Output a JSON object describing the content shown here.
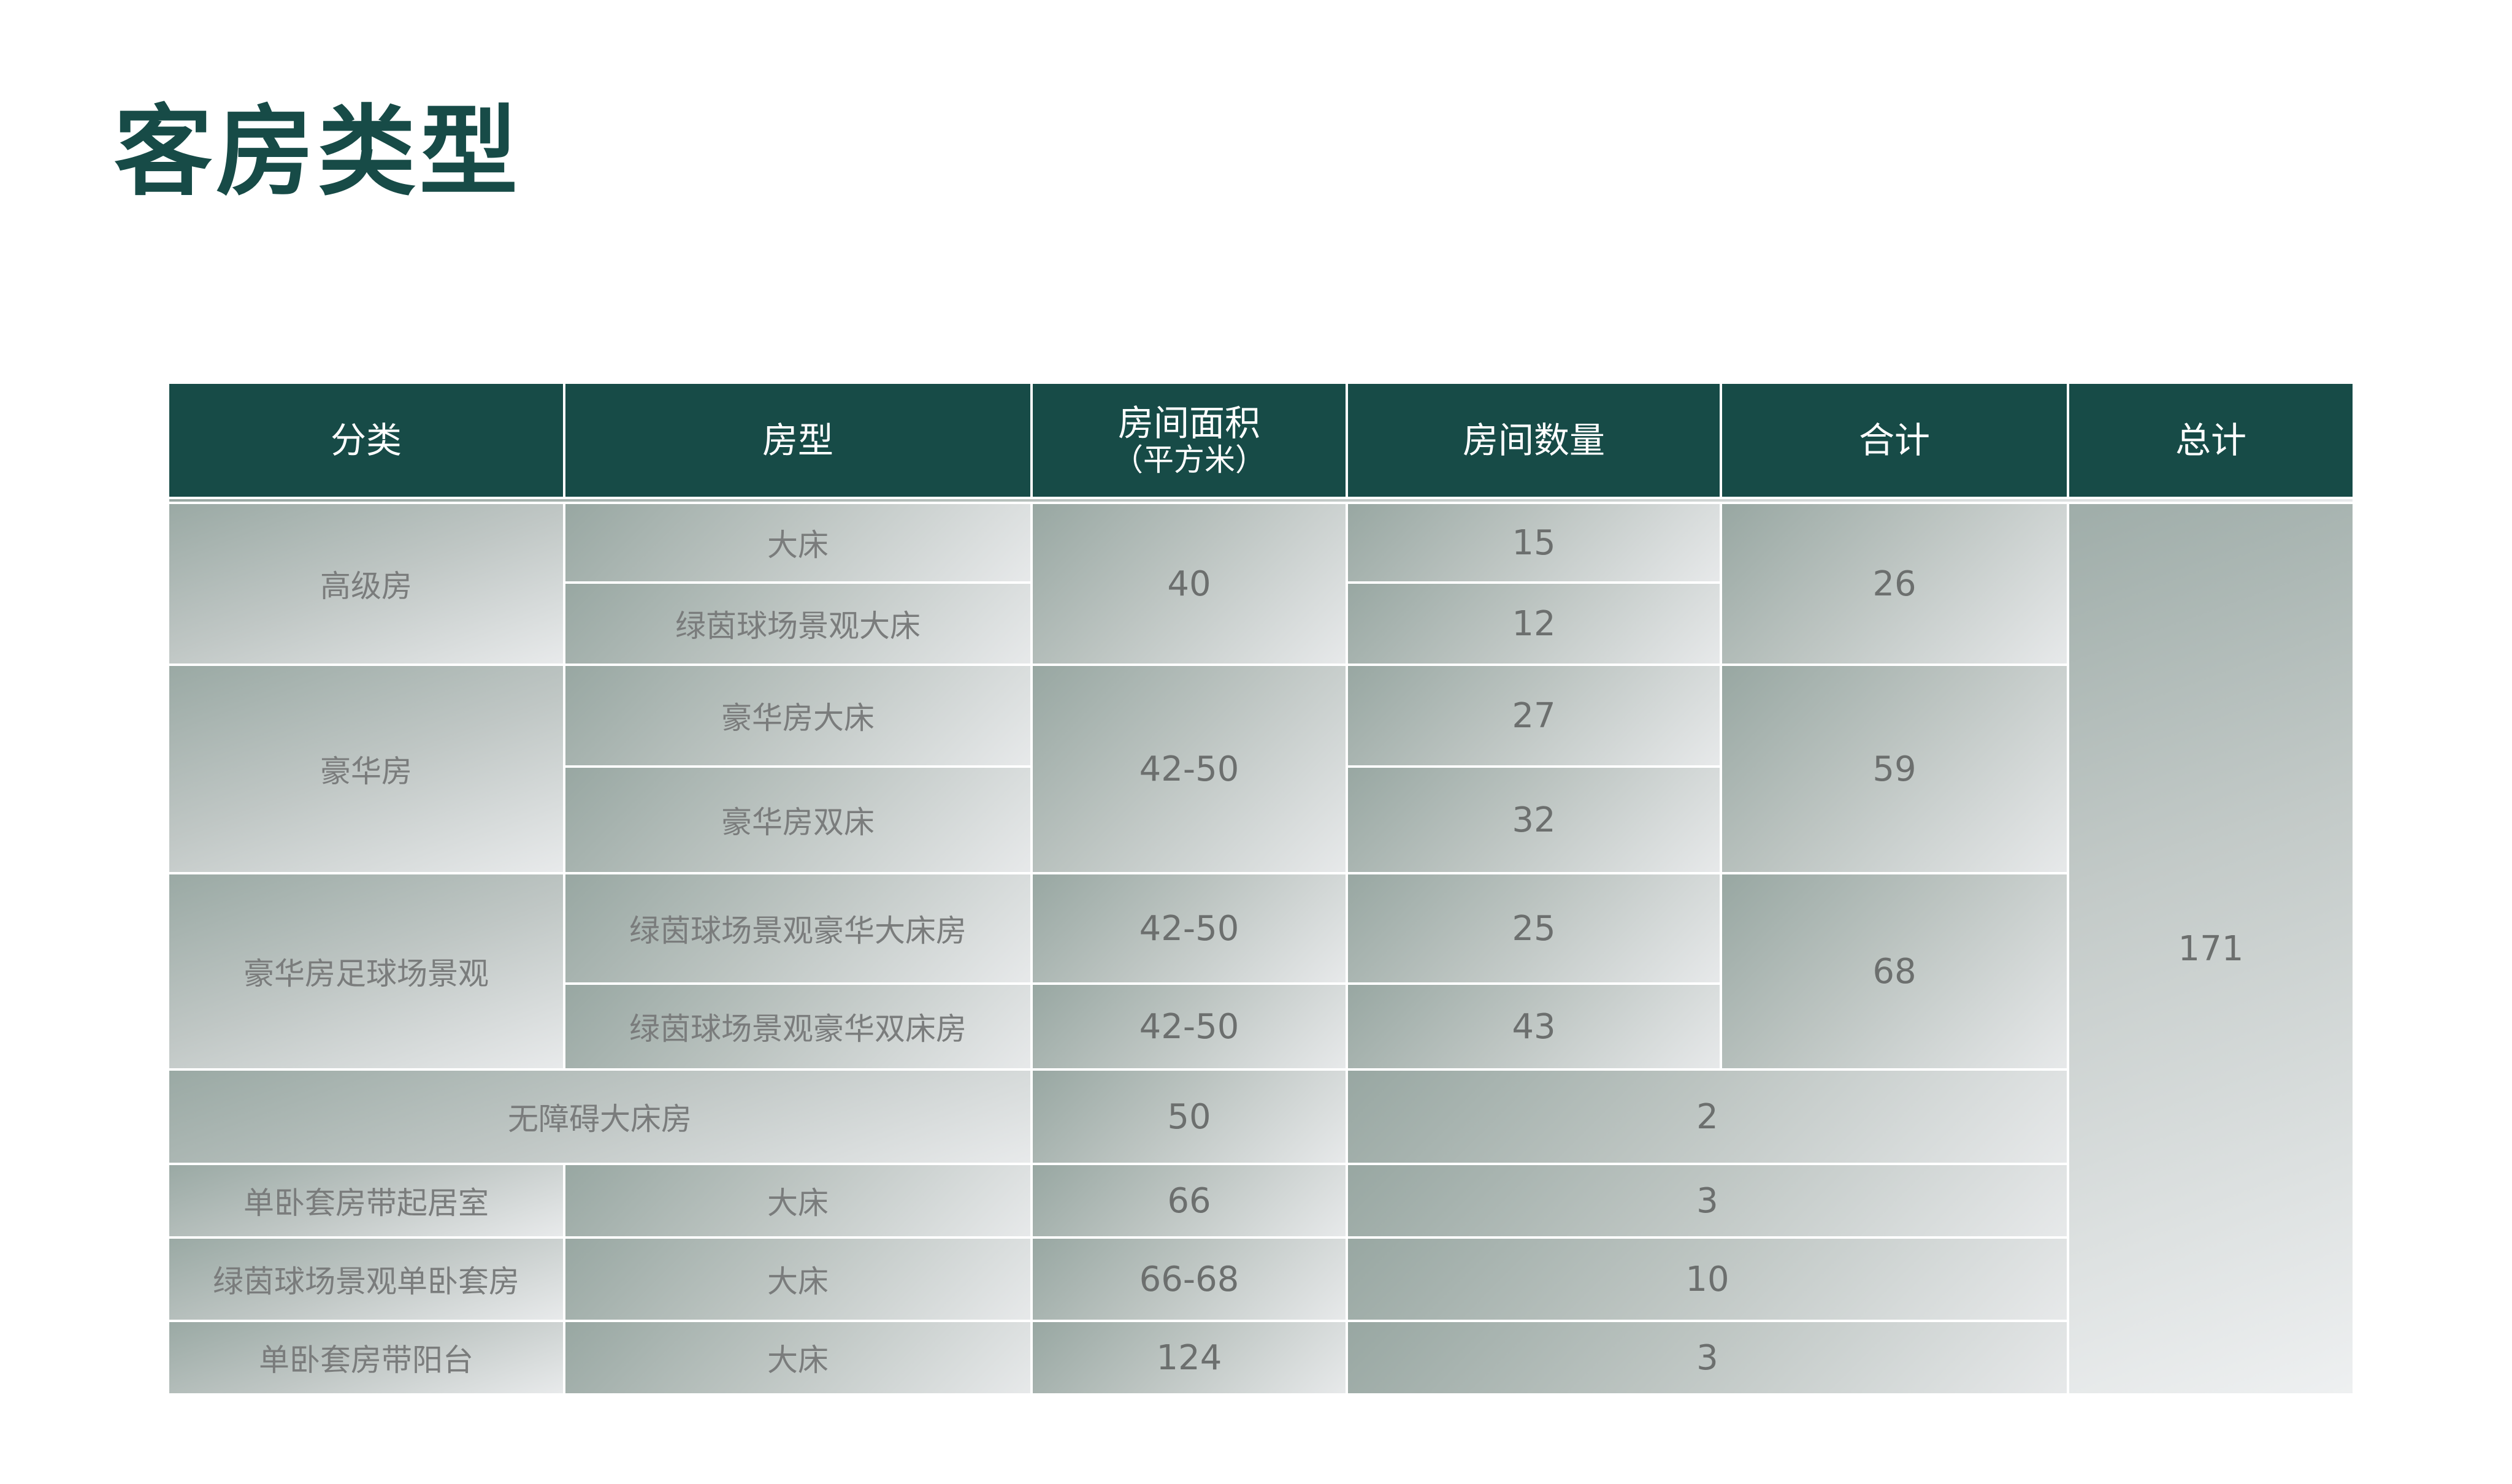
{
  "page": {
    "title": "客房类型"
  },
  "table": {
    "headers": {
      "category": "分类",
      "room_type": "房型",
      "area_line1": "房间面积",
      "area_line2": "（平方米）",
      "count": "房间数量",
      "subtotal": "合计",
      "total": "总计"
    },
    "total": "171",
    "groups": [
      {
        "category": "高级房",
        "area": "40",
        "subtotal": "26",
        "rows": [
          {
            "room_type": "大床",
            "count": "15"
          },
          {
            "room_type": "绿茵球场景观大床",
            "count": "12"
          }
        ]
      },
      {
        "category": "豪华房",
        "area": "42-50",
        "subtotal": "59",
        "rows": [
          {
            "room_type": "豪华房大床",
            "count": "27"
          },
          {
            "room_type": "豪华房双床",
            "count": "32"
          }
        ]
      },
      {
        "category": "豪华房足球场景观",
        "subtotal": "68",
        "rows": [
          {
            "room_type": "绿茵球场景观豪华大床房",
            "area": "42-50",
            "count": "25"
          },
          {
            "room_type": "绿茵球场景观豪华双床房",
            "area": "42-50",
            "count": "43"
          }
        ]
      }
    ],
    "accessible": {
      "name": "无障碍大床房",
      "area": "50",
      "count": "2"
    },
    "suites": [
      {
        "category": "单卧套房带起居室",
        "room_type": "大床",
        "area": "66",
        "count": "3"
      },
      {
        "category": "绿茵球场景观单卧套房",
        "room_type": "大床",
        "area": "66-68",
        "count": "10"
      },
      {
        "category": "单卧套房带阳台",
        "room_type": "大床",
        "area": "124",
        "count": "3"
      }
    ]
  }
}
